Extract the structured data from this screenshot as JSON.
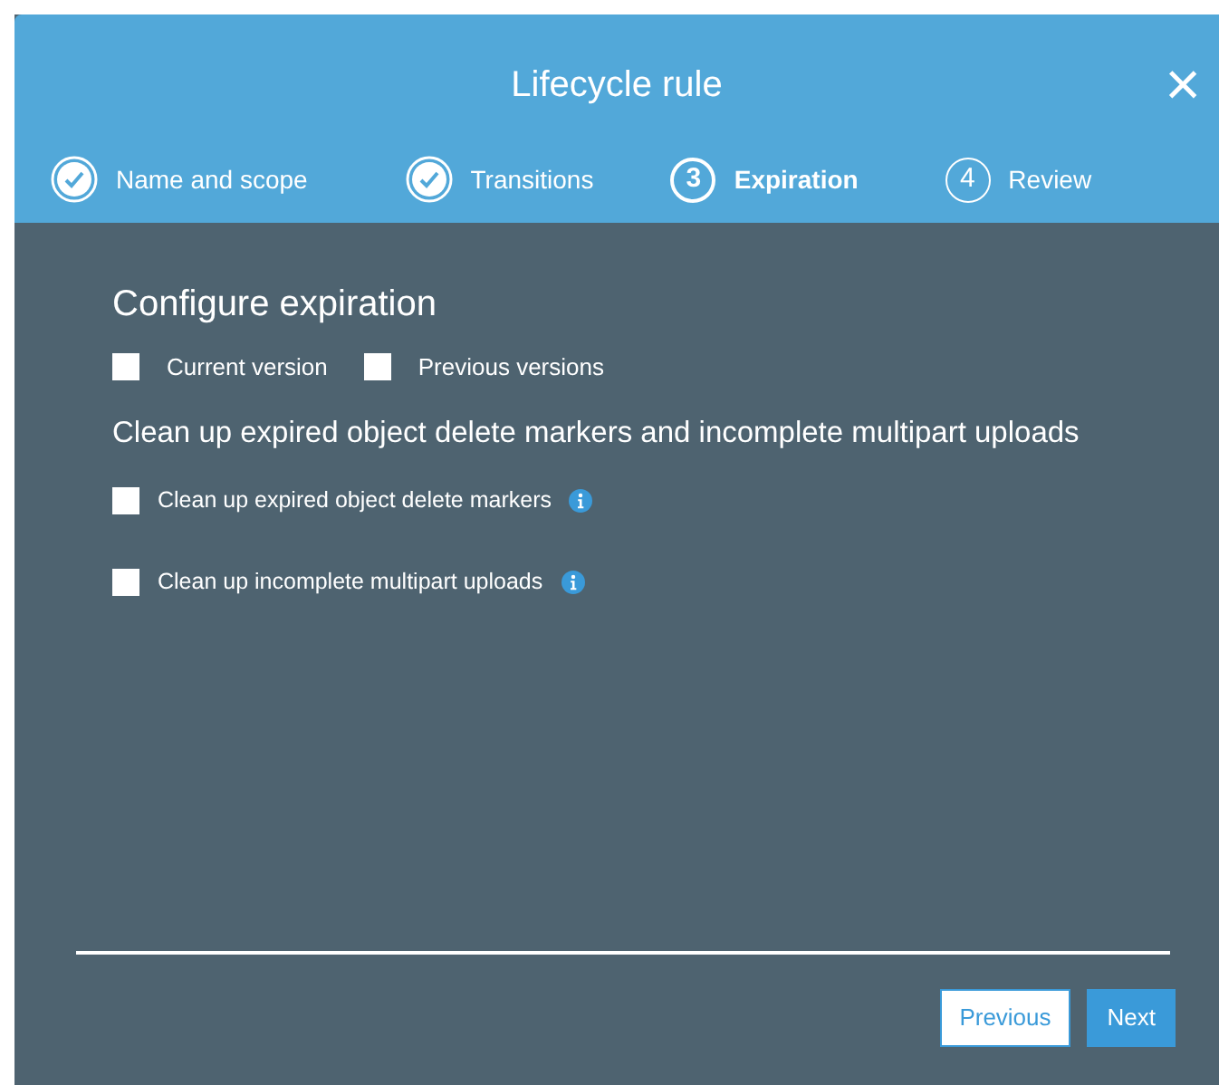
{
  "dialog": {
    "title": "Lifecycle rule",
    "close": "×"
  },
  "steps": [
    {
      "label": "Name and scope",
      "done": true,
      "selected": false
    },
    {
      "label": "Transitions",
      "done": true,
      "selected": false
    },
    {
      "number": "3",
      "label": "Expiration",
      "done": false,
      "selected": true
    },
    {
      "number": "4",
      "label": "Review",
      "done": false,
      "selected": false
    }
  ],
  "section_title": "Configure expiration",
  "versions": [
    {
      "label": "Current version",
      "checked": false
    },
    {
      "label": "Previous versions",
      "checked": false
    }
  ],
  "cleanup_title": "Clean up expired object delete markers and incomplete multipart uploads",
  "cleanup_options": [
    {
      "label": "Clean up expired object delete markers",
      "checked": false,
      "info": true
    },
    {
      "label": "Clean up incomplete multipart uploads",
      "checked": false,
      "info": true
    }
  ],
  "buttons": [
    {
      "label": "Previous",
      "kind": "secondary"
    },
    {
      "label": "Next",
      "kind": "primary"
    }
  ]
}
